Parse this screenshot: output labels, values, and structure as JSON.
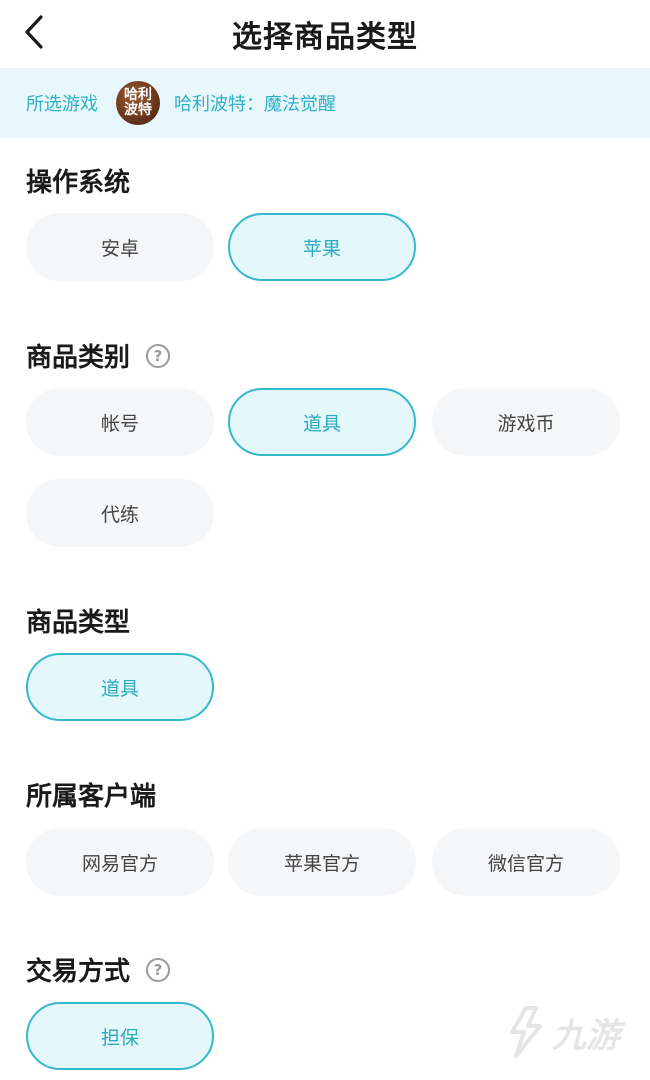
{
  "header": {
    "title": "选择商品类型"
  },
  "game": {
    "label": "所选游戏",
    "logo_text": "哈利波特",
    "name": "哈利波特：魔法觉醒"
  },
  "sections": {
    "os": {
      "title": "操作系统",
      "options": [
        "安卓",
        "苹果"
      ]
    },
    "category": {
      "title": "商品类别",
      "options": [
        "帐号",
        "道具",
        "游戏币",
        "代练"
      ]
    },
    "type": {
      "title": "商品类型",
      "options": [
        "道具"
      ]
    },
    "client": {
      "title": "所属客户端",
      "options": [
        "网易官方",
        "苹果官方",
        "微信官方"
      ]
    },
    "trade": {
      "title": "交易方式",
      "options": [
        "担保"
      ]
    }
  },
  "watermark": {
    "text": "九游"
  },
  "colors": {
    "accent": "#35b8cd",
    "accent_text": "#2aa9c0",
    "selected_bg": "#e4f8fc",
    "chip_bg": "#f5f6f8",
    "banner_bg": "#e8f7fb"
  }
}
